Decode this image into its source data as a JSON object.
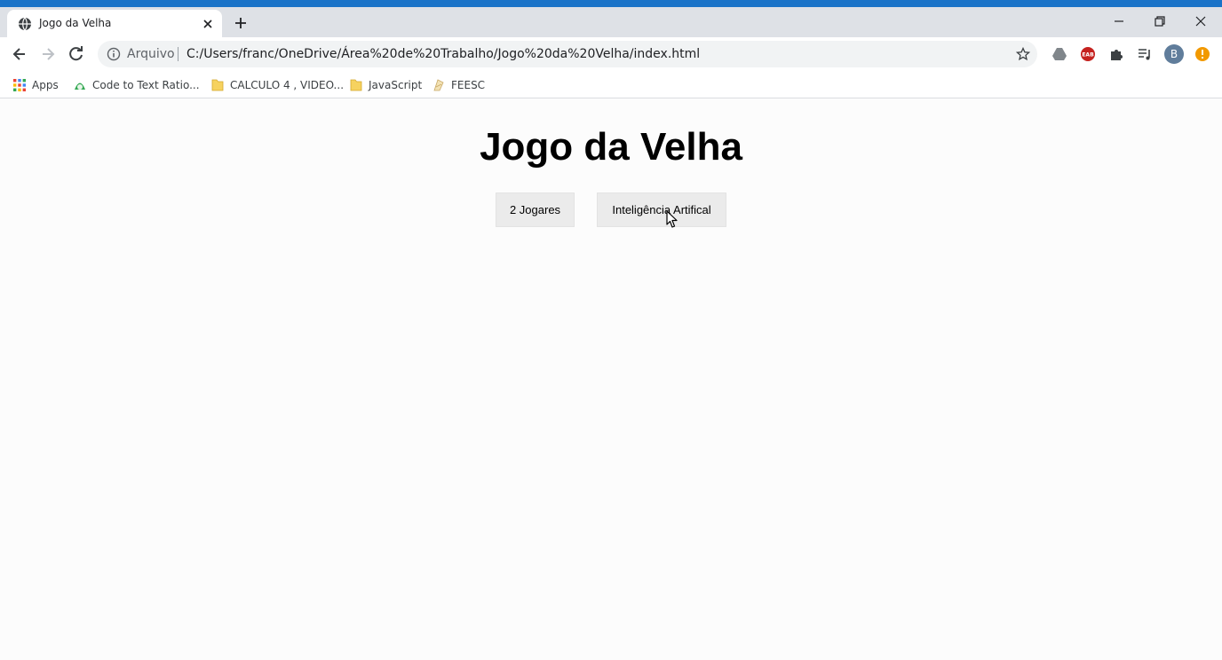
{
  "browser": {
    "tab_title": "Jogo da Velha",
    "scheme_label": "Arquivo",
    "url": "C:/Users/franc/OneDrive/Área%20de%20Trabalho/Jogo%20da%20Velha/index.html",
    "profile_initial": "B",
    "extension_badge": "EAB",
    "accent_color": "#1a73c8"
  },
  "bookmarks": [
    {
      "label": "Apps",
      "icon": "apps-grid-icon"
    },
    {
      "label": "Code to Text Ratio...",
      "icon": "code-ratio-icon"
    },
    {
      "label": "CALCULO 4 , VIDEO...",
      "icon": "folder-icon"
    },
    {
      "label": "JavaScript",
      "icon": "folder-icon"
    },
    {
      "label": "FEESC",
      "icon": "feesc-icon"
    }
  ],
  "page": {
    "title": "Jogo da Velha",
    "buttons": [
      {
        "label": "2 Jogares"
      },
      {
        "label": "Inteligência Artifical"
      }
    ]
  }
}
